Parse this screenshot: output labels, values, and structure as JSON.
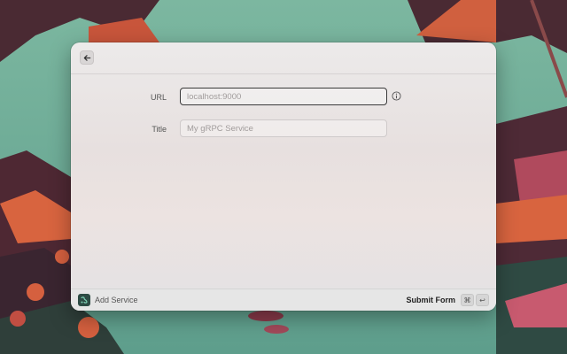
{
  "background": {
    "sky": "#6fae9a",
    "rock_dark": "#5b2f35",
    "rock_orange": "#d8643f",
    "rock_pink": "#b05062"
  },
  "topbar": {
    "back_icon": "arrow-left-icon"
  },
  "form": {
    "url": {
      "label": "URL",
      "placeholder": "localhost:9000",
      "info_icon": "info-icon"
    },
    "title": {
      "label": "Title",
      "placeholder": "My gRPC Service"
    }
  },
  "footer": {
    "extension_icon": "grpc-extension-icon",
    "title": "Add Service",
    "action_label": "Submit Form",
    "shortcut": {
      "modifier": "⌘",
      "key": "↩"
    }
  }
}
